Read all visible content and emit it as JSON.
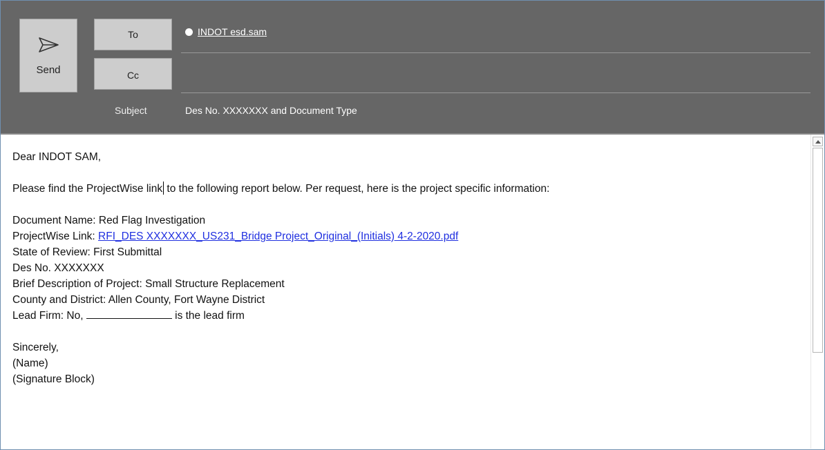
{
  "header": {
    "send_label": "Send",
    "to_label": "To",
    "cc_label": "Cc",
    "to_recipient": "INDOT esd.sam",
    "cc_value": "",
    "subject_label": "Subject",
    "subject_value": "Des No. XXXXXXX and Document Type"
  },
  "body": {
    "greeting": "Dear INDOT SAM,",
    "intro_part1": "Please find the ProjectWise link",
    "intro_part2": " to the following report below. Per request, here is the project specific information:",
    "doc_name": "Document Name: Red Flag Investigation",
    "pw_link_label": "ProjectWise Link: ",
    "pw_link_text": "RFI_DES XXXXXXX_US231_Bridge Project_Original_(Initials) 4-2-2020.pdf",
    "state_review": "State of Review: First Submittal",
    "des_no": "Des No. XXXXXXX",
    "brief_desc": "Brief Description of Project: Small Structure Replacement",
    "county": "County and District: Allen County, Fort Wayne District",
    "lead_firm_prefix": "Lead Firm: No, ",
    "lead_firm_suffix": " is the lead firm",
    "closing": "Sincerely,",
    "name": "(Name)",
    "signature": "(Signature Block)"
  },
  "icons": {
    "send": "send-paper-plane-icon",
    "scroll_up": "scroll-up-arrow-icon"
  },
  "colors": {
    "header_bg": "#666666",
    "button_bg": "#cdcdcd",
    "link": "#1f2fe0"
  }
}
